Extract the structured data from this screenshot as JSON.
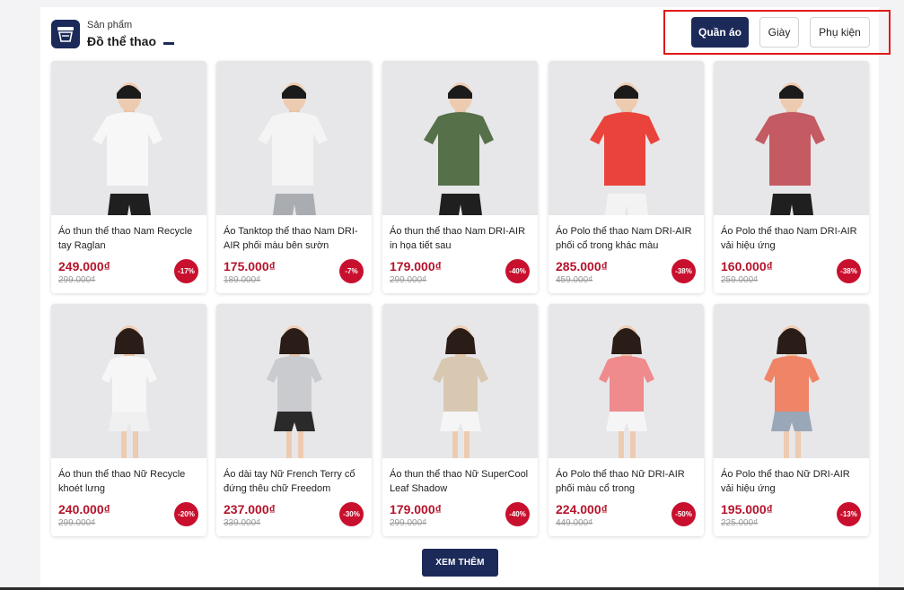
{
  "header": {
    "subtitle": "Sản phẩm",
    "title": "Đồ thể thao"
  },
  "tabs": [
    {
      "label": "Quần áo",
      "active": true
    },
    {
      "label": "Giày",
      "active": false
    },
    {
      "label": "Phụ kiện",
      "active": false
    }
  ],
  "products": [
    {
      "name": "Áo thun thể thao Nam Recycle tay Raglan",
      "price": "249.000₫",
      "old_price": "299.000₫",
      "discount": "-17%",
      "shirt_color": "#f7f7f7",
      "bottom_color": "#1f1f1f",
      "gender": "male"
    },
    {
      "name": "Áo Tanktop thể thao Nam DRI-AIR phối màu bên sườn",
      "price": "175.000₫",
      "old_price": "189.000₫",
      "discount": "-7%",
      "shirt_color": "#f4f4f4",
      "bottom_color": "#a9adb2",
      "gender": "male"
    },
    {
      "name": "Áo thun thể thao Nam DRI-AIR in họa tiết sau",
      "price": "179.000₫",
      "old_price": "299.000₫",
      "discount": "-40%",
      "shirt_color": "#56704a",
      "bottom_color": "#1f1f1f",
      "gender": "male"
    },
    {
      "name": "Áo Polo thể thao Nam DRI-AIR phối cổ trong khác màu",
      "price": "285.000₫",
      "old_price": "459.000₫",
      "discount": "-38%",
      "shirt_color": "#e9433b",
      "bottom_color": "#f3f3f3",
      "gender": "male"
    },
    {
      "name": "Áo Polo thể thao Nam DRI-AIR vải hiệu ứng",
      "price": "160.000₫",
      "old_price": "259.000₫",
      "discount": "-38%",
      "shirt_color": "#c45a62",
      "bottom_color": "#1f1f1f",
      "gender": "male"
    },
    {
      "name": "Áo thun thể thao Nữ Recycle khoét lưng",
      "price": "240.000₫",
      "old_price": "299.000₫",
      "discount": "-20%",
      "shirt_color": "#f6f6f6",
      "bottom_color": "#f0f0f0",
      "gender": "female"
    },
    {
      "name": "Áo dài tay Nữ French Terry cổ đứng thêu chữ Freedom",
      "price": "237.000₫",
      "old_price": "339.000₫",
      "discount": "-30%",
      "shirt_color": "#c9cbce",
      "bottom_color": "#2a2a2a",
      "gender": "female"
    },
    {
      "name": "Áo thun thể thao Nữ SuperCool Leaf Shadow",
      "price": "179.000₫",
      "old_price": "299.000₫",
      "discount": "-40%",
      "shirt_color": "#d8c8b2",
      "bottom_color": "#f5f5f5",
      "gender": "female"
    },
    {
      "name": "Áo Polo thể thao Nữ DRI-AIR phối màu cổ trong",
      "price": "224.000₫",
      "old_price": "449.000₫",
      "discount": "-50%",
      "shirt_color": "#ef8a8d",
      "bottom_color": "#f5f5f5",
      "gender": "female"
    },
    {
      "name": "Áo Polo thể thao Nữ DRI-AIR vải hiệu ứng",
      "price": "195.000₫",
      "old_price": "225.000₫",
      "discount": "-13%",
      "shirt_color": "#f08466",
      "bottom_color": "#9aa7b8",
      "gender": "female"
    }
  ],
  "more_button": "XEM THÊM",
  "colors": {
    "brand_navy": "#1c2a5a",
    "price_red": "#b5142b",
    "badge_red": "#c8102e",
    "highlight_red": "#e11919"
  }
}
